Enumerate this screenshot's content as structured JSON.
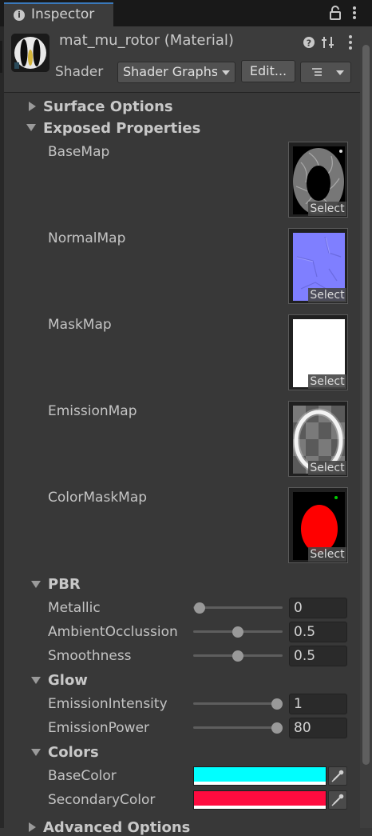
{
  "tab": {
    "title": "Inspector"
  },
  "header": {
    "material_title": "mat_mu_rotor (Material)",
    "shader_label": "Shader",
    "shader_value": "Shader Graphs/",
    "edit_label": "Edit..."
  },
  "foldouts": {
    "surface_options": "Surface Options",
    "exposed_properties": "Exposed Properties",
    "pbr": "PBR",
    "glow": "Glow",
    "colors": "Colors",
    "advanced_options": "Advanced Options"
  },
  "textures": [
    {
      "label": "BaseMap",
      "select": "Select"
    },
    {
      "label": "NormalMap",
      "select": "Select"
    },
    {
      "label": "MaskMap",
      "select": "Select"
    },
    {
      "label": "EmissionMap",
      "select": "Select"
    },
    {
      "label": "ColorMaskMap",
      "select": "Select"
    }
  ],
  "sliders": {
    "metallic": {
      "label": "Metallic",
      "value": "0",
      "fraction": 0.0
    },
    "ambient_occlusion": {
      "label": "AmbientOcclussion",
      "value": "0.5",
      "fraction": 0.5
    },
    "smoothness": {
      "label": "Smoothness",
      "value": "0.5",
      "fraction": 0.5
    },
    "emission_intensity": {
      "label": "EmissionIntensity",
      "value": "1",
      "fraction": 1.0
    },
    "emission_power": {
      "label": "EmissionPower",
      "value": "80",
      "fraction": 1.0
    }
  },
  "colors": {
    "base_color": {
      "label": "BaseColor",
      "hex": "#00ffff"
    },
    "secondary_color": {
      "label": "SecondaryColor",
      "hex": "#ff0b3f"
    }
  }
}
